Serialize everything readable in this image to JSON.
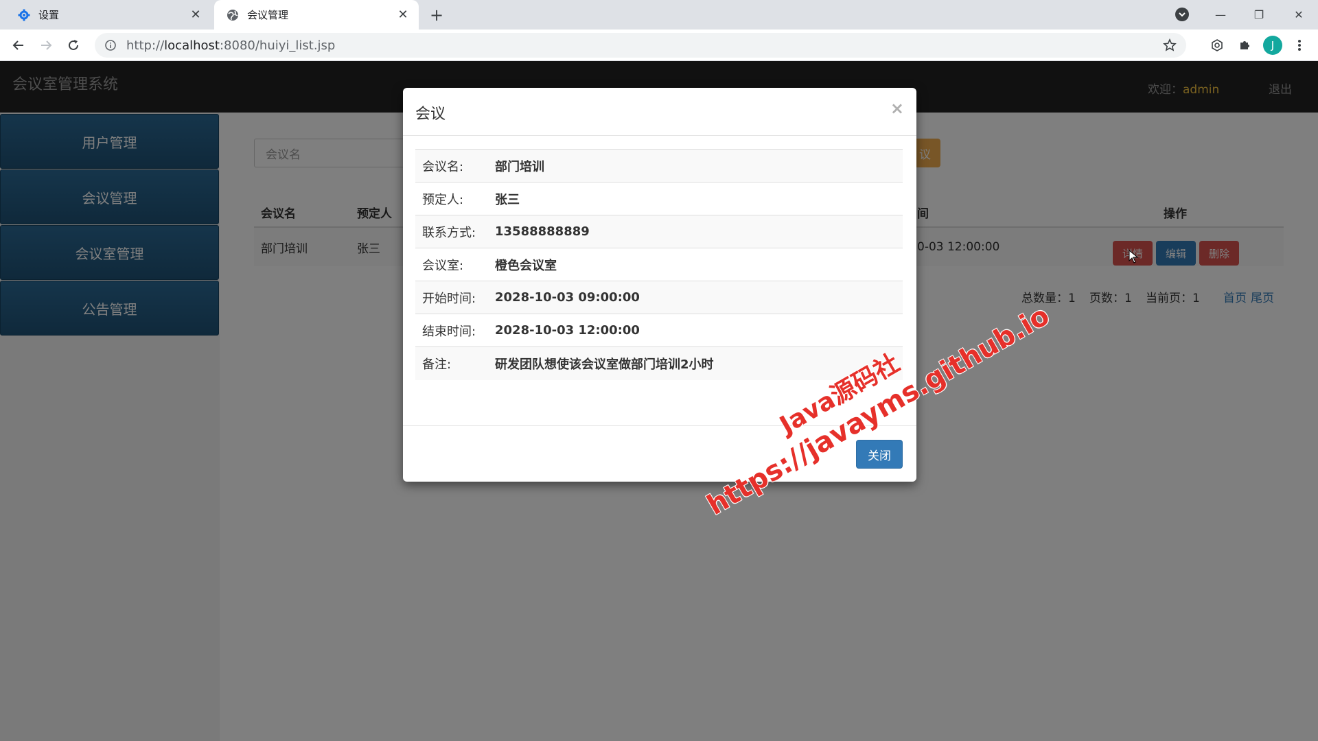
{
  "browser": {
    "tabs": [
      {
        "title": "设置",
        "icon": "gear-icon",
        "active": false
      },
      {
        "title": "会议管理",
        "icon": "globe-icon",
        "active": true
      }
    ],
    "url_prefix": "http://",
    "url_host": "localhost",
    "url_rest": ":8080/huiyi_list.jsp",
    "profile_initial": "J"
  },
  "app": {
    "brand": "会议室管理系统",
    "welcome_label": "欢迎：",
    "username": "admin",
    "logout": "退出"
  },
  "sidebar": {
    "items": [
      {
        "label": "用户管理"
      },
      {
        "label": "会议管理"
      },
      {
        "label": "会议室管理"
      },
      {
        "label": "公告管理"
      }
    ]
  },
  "main": {
    "search_placeholder": "会议名",
    "add_button_partial": "议",
    "columns": {
      "name": "会议名",
      "booker": "预定人",
      "time_partial": "间",
      "actions": "操作"
    },
    "row": {
      "name": "部门培训",
      "booker": "张三",
      "time_partial": "0-03 12:00:00",
      "detail_btn": "详情",
      "edit_btn": "编辑",
      "delete_btn": "删除"
    },
    "pager": {
      "total": "总数量：1",
      "pages": "页数：1",
      "current": "当前页：1",
      "first": "首页",
      "last": "尾页"
    }
  },
  "modal": {
    "title": "会议",
    "close_x": "×",
    "fields": [
      {
        "label": "会议名:",
        "value": "部门培训"
      },
      {
        "label": "预定人:",
        "value": "张三"
      },
      {
        "label": "联系方式:",
        "value": "13588888889"
      },
      {
        "label": "会议室:",
        "value": "橙色会议室"
      },
      {
        "label": "开始时间:",
        "value": "2028-10-03 09:00:00"
      },
      {
        "label": "结束时间:",
        "value": "2028-10-03 12:00:00"
      },
      {
        "label": "备注:",
        "value": "研发团队想使该会议室做部门培训2小时"
      }
    ],
    "close_button": "关闭"
  },
  "watermark": {
    "line1": "Java源码社",
    "line2": "https://javayms.github.io"
  },
  "colors": {
    "navbar": "#222222",
    "sidebar_item": "#24618b",
    "primary": "#337ab7",
    "danger": "#c9302c",
    "warning": "#f0ad4e",
    "watermark": "#e6302a"
  }
}
